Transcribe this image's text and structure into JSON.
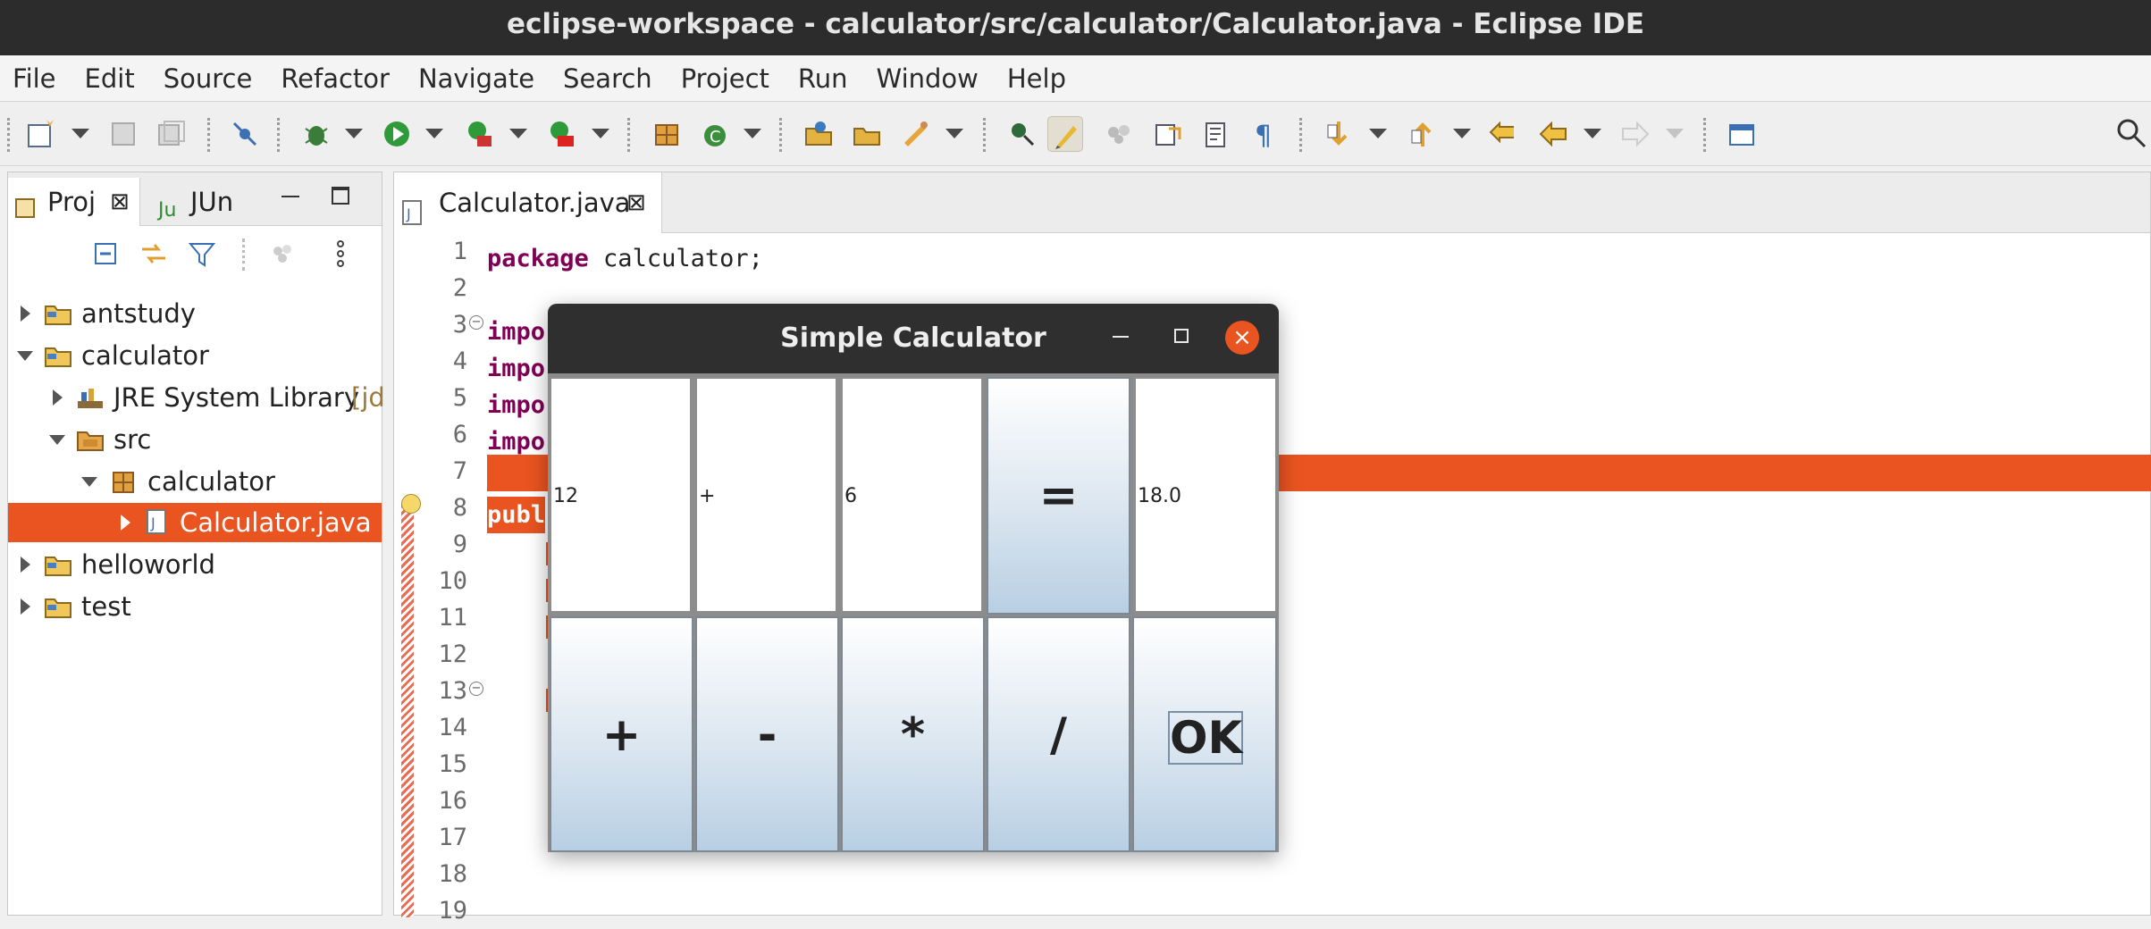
{
  "window": {
    "title": "eclipse-workspace - calculator/src/calculator/Calculator.java - Eclipse IDE"
  },
  "menubar": {
    "items": [
      "File",
      "Edit",
      "Source",
      "Refactor",
      "Navigate",
      "Search",
      "Project",
      "Run",
      "Window",
      "Help"
    ]
  },
  "left_panel": {
    "tabs": [
      {
        "label": "Proj"
      },
      {
        "label": "JUn"
      }
    ],
    "tree": [
      {
        "label": "antstudy"
      },
      {
        "label": "calculator"
      },
      {
        "label": "JRE System Library",
        "suffix": "[jd"
      },
      {
        "label": "src"
      },
      {
        "label": "calculator"
      },
      {
        "label": "Calculator.java"
      },
      {
        "label": "helloworld"
      },
      {
        "label": "test"
      }
    ]
  },
  "editor": {
    "tab_label": "Calculator.java",
    "line_numbers": [
      "1",
      "2",
      "3",
      "4",
      "5",
      "6",
      "7",
      "8",
      "9",
      "10",
      "11",
      "12",
      "13",
      "14",
      "15",
      "16",
      "17",
      "18",
      "19"
    ],
    "code": {
      "l1_kw": "package",
      "l1_rest": " calculator;",
      "l3": "impo",
      "l4": "impo",
      "l5": "impo",
      "l6": "impo",
      "l8": "publ"
    }
  },
  "dialog": {
    "title": "Simple Calculator",
    "close_glyph": "×",
    "fields": {
      "operand1": "12",
      "operator": "+",
      "operand2": "6",
      "result": "18.0"
    },
    "equals_label": "=",
    "buttons": {
      "add": "+",
      "subtract": "-",
      "multiply": "*",
      "divide": "/",
      "ok": "OK"
    }
  },
  "colors": {
    "accent": "#e95420",
    "keyword": "#7f0055",
    "titlebar": "#2c2c2c"
  }
}
